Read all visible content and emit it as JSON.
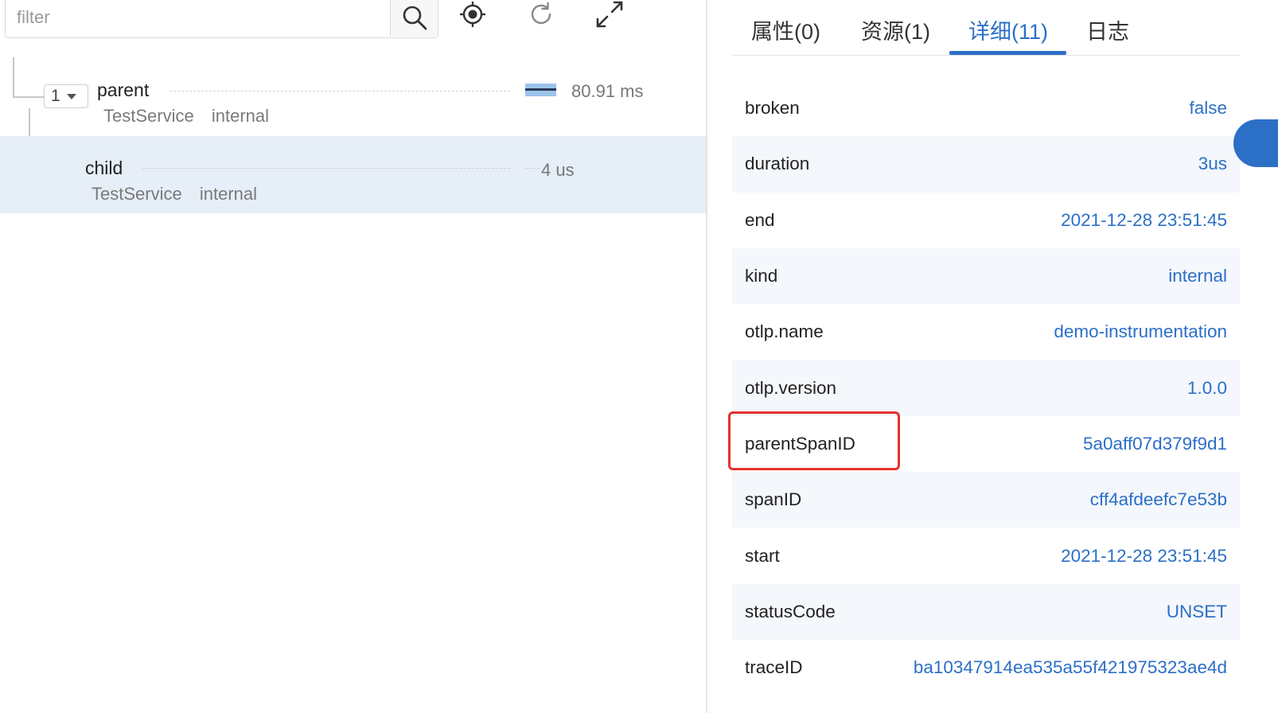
{
  "search": {
    "placeholder": "filter"
  },
  "toolbar_icons": [
    "search-icon",
    "locate-icon",
    "refresh-icon",
    "fullscreen-icon"
  ],
  "spans": [
    {
      "name": "parent",
      "service": "TestService",
      "kind": "internal",
      "duration": "80.91 ms",
      "collapse_count": "1"
    },
    {
      "name": "child",
      "service": "TestService",
      "kind": "internal",
      "duration": "4 us"
    }
  ],
  "tabs": [
    {
      "label": "属性(0)"
    },
    {
      "label": "资源(1)"
    },
    {
      "label": "详细(11)",
      "active": true
    },
    {
      "label": "日志"
    }
  ],
  "details": [
    {
      "key": "broken",
      "value": "false"
    },
    {
      "key": "duration",
      "value": "3us"
    },
    {
      "key": "end",
      "value": "2021-12-28 23:51:45"
    },
    {
      "key": "kind",
      "value": "internal"
    },
    {
      "key": "otlp.name",
      "value": "demo-instrumentation"
    },
    {
      "key": "otlp.version",
      "value": "1.0.0"
    },
    {
      "key": "parentSpanID",
      "value": "5a0aff07d379f9d1"
    },
    {
      "key": "spanID",
      "value": "cff4afdeefc7e53b"
    },
    {
      "key": "start",
      "value": "2021-12-28 23:51:45"
    },
    {
      "key": "statusCode",
      "value": "UNSET"
    },
    {
      "key": "traceID",
      "value": "ba10347914ea535a55f421975323ae4d"
    }
  ],
  "colors": {
    "accent": "#2c6fc7",
    "highlight": "#e5322d",
    "selected_row": "#e6eef7",
    "alt_row": "#f4f7fb"
  }
}
